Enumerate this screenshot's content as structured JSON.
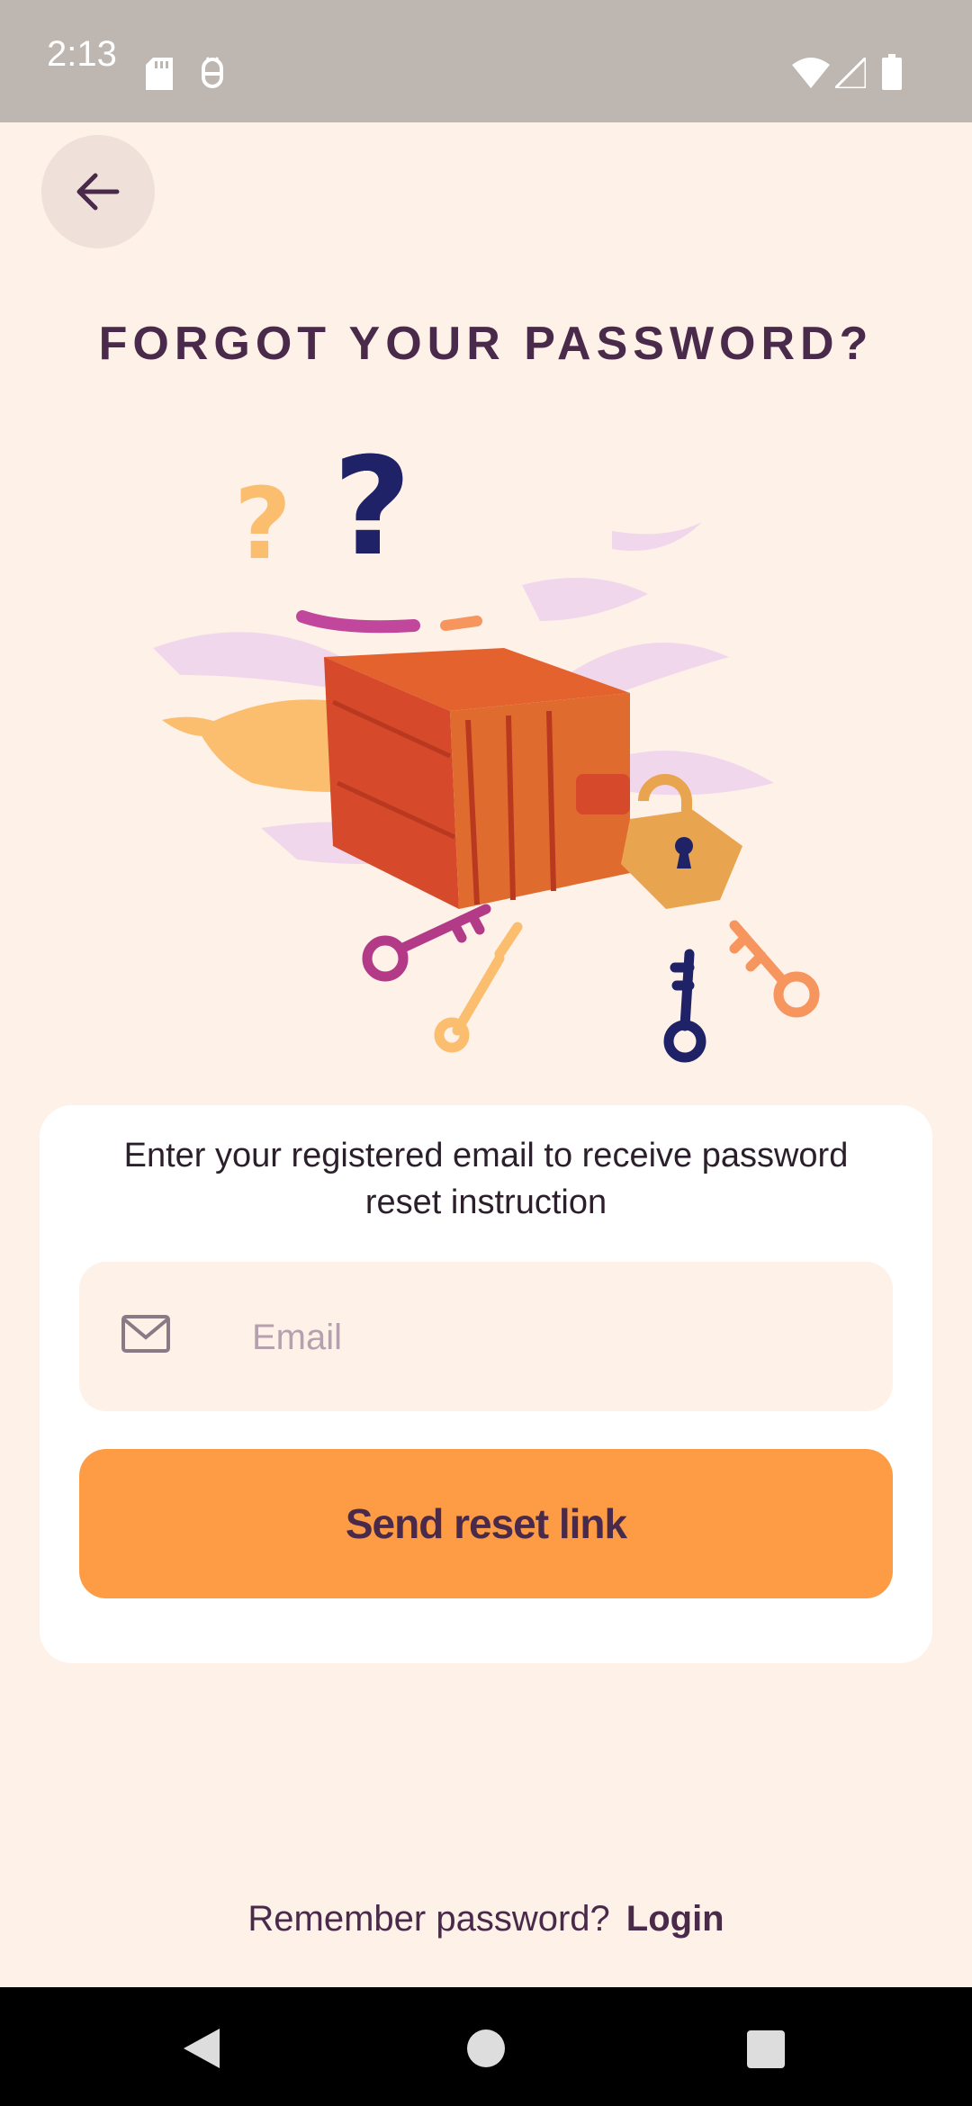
{
  "status_bar": {
    "time": "2:13",
    "icons": [
      "sd-card-icon",
      "debug-icon",
      "wifi-icon",
      "signal-icon",
      "battery-icon"
    ]
  },
  "header": {
    "back_icon": "arrow-left-icon"
  },
  "page": {
    "title": "FORGOT YOUR PASSWORD?",
    "illustration": "locked-chest-with-keys"
  },
  "form": {
    "instruction": "Enter your registered email to receive password reset instruction",
    "email": {
      "icon": "mail-icon",
      "placeholder": "Email",
      "value": ""
    },
    "submit_label": "Send reset link"
  },
  "footer": {
    "prompt": "Remember password?",
    "login_label": "Login"
  },
  "colors": {
    "background": "#FEF1E8",
    "title": "#4A2A4A",
    "accent": "#FD9C45",
    "card": "#FFFFFF"
  }
}
